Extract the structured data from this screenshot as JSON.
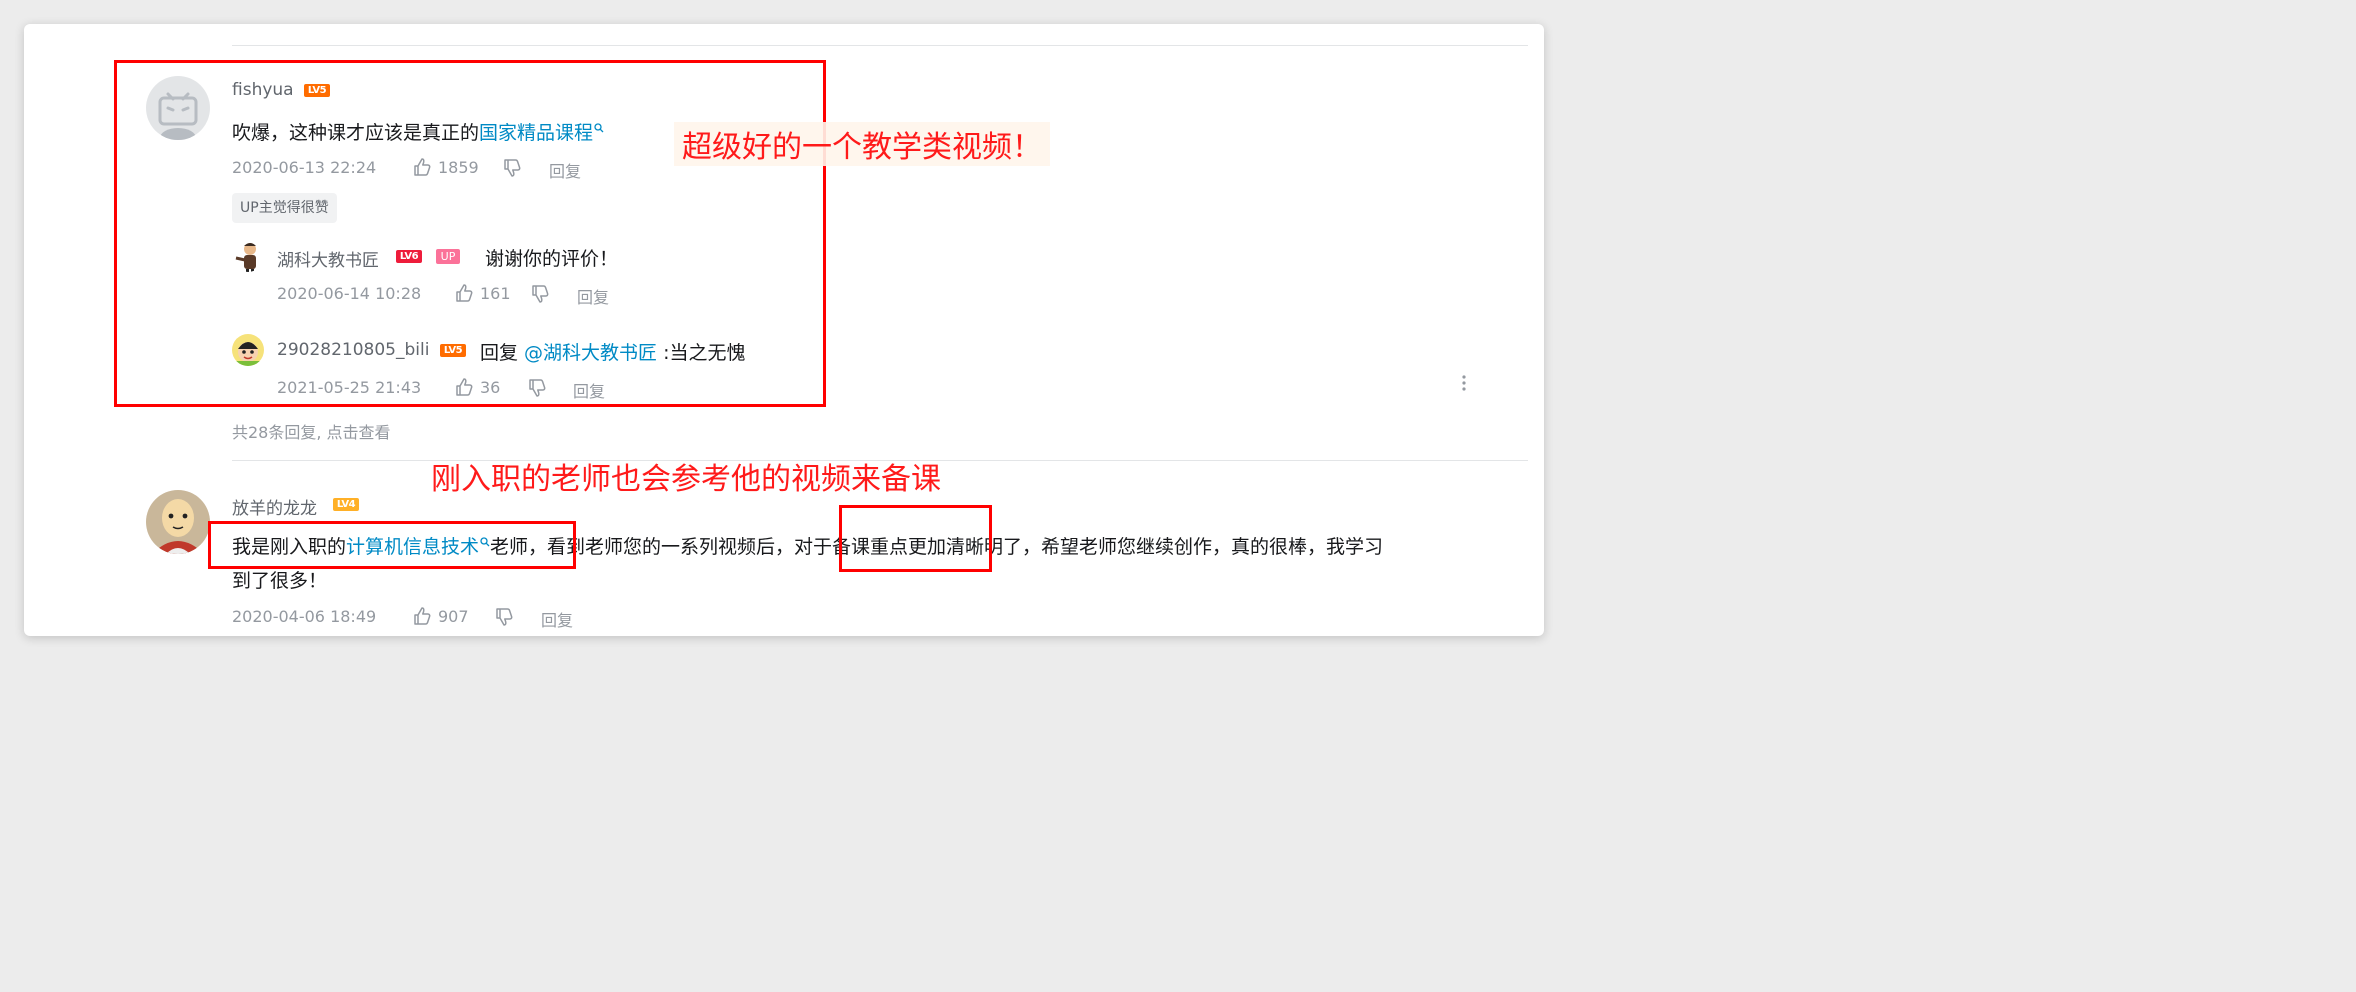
{
  "comments": [
    {
      "username": "fishyua",
      "level": "LV5",
      "text_prefix": "吹爆，这种课才应该是真正的",
      "link_text": "国家精品课程",
      "date": "2020-06-13 22:24",
      "likes": "1859",
      "reply_label": "回复",
      "tag": "UP主觉得很赞",
      "replies": [
        {
          "username": "湖科大教书匠",
          "level": "LV6",
          "up_badge": "UP",
          "text": "谢谢你的评价！",
          "date": "2020-06-14 10:28",
          "likes": "161",
          "reply_label": "回复"
        },
        {
          "username": "29028210805_bili",
          "level": "LV5",
          "text_prefix": "回复 ",
          "mention": "@湖科大教书匠",
          "text_suffix": " :当之无愧",
          "date": "2021-05-25 21:43",
          "likes": "36",
          "reply_label": "回复"
        }
      ],
      "more_replies": "共28条回复, 点击查看"
    },
    {
      "username": "放羊的龙龙",
      "level": "LV4",
      "text_prefix": "我是刚入职的",
      "link_text": "计算机信息技术",
      "text_line1_suffix": "老师，看到老师您的一系列视频后，对于备课重点更加清晰明了，希望老师您继续创作，真的很棒，我学习",
      "text_line2": "到了很多！",
      "date": "2020-04-06 18:49",
      "likes": "907",
      "reply_label": "回复"
    }
  ],
  "annotations": {
    "first": "超级好的一个教学类视频！",
    "second": "刚入职的老师也会参考他的视频来备课"
  },
  "colors": {
    "link": "#008ac5",
    "annotation": "#ff0000",
    "meta": "#9499a0"
  }
}
